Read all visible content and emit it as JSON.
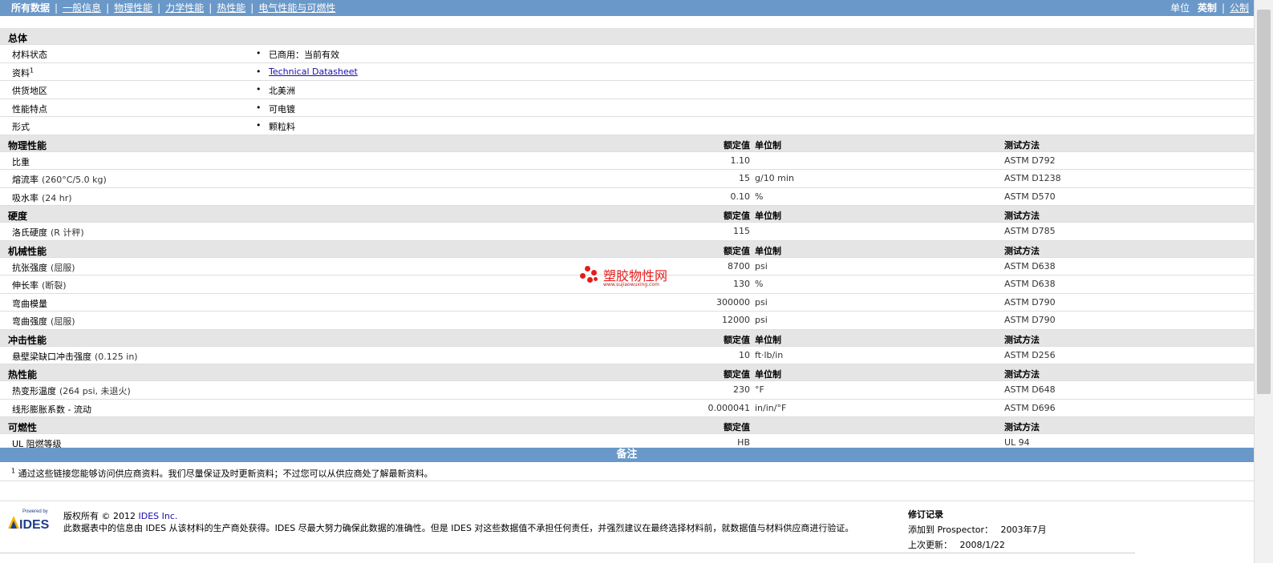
{
  "nav": {
    "items": [
      "所有数据",
      "一般信息",
      "物理性能",
      "力学性能",
      "热性能",
      "电气性能与可燃性"
    ],
    "units_label": "单位",
    "english": "英制",
    "metric": "公制"
  },
  "general": {
    "title": "总体",
    "rows": [
      {
        "label": "材料状态",
        "value": "已商用：当前有效"
      },
      {
        "label": "资料",
        "sup": "1",
        "value": "Technical Datasheet"
      },
      {
        "label": "供货地区",
        "value": "北美洲"
      },
      {
        "label": "性能特点",
        "value": "可电镀"
      },
      {
        "label": "形式",
        "value": "颗粒料"
      }
    ]
  },
  "col_headers": {
    "value": "额定值",
    "unit": "单位制",
    "method": "测试方法"
  },
  "sections": [
    {
      "title": "物理性能",
      "rows": [
        {
          "label": "比重",
          "cond": "",
          "value": "1.10",
          "unit": "",
          "method": "ASTM D792"
        },
        {
          "label": "熔流率",
          "cond": "(260°C/5.0 kg)",
          "value": "15",
          "unit": "g/10 min",
          "method": "ASTM D1238"
        },
        {
          "label": "吸水率",
          "cond": "(24 hr)",
          "value": "0.10",
          "unit": "%",
          "method": "ASTM D570"
        }
      ]
    },
    {
      "title": "硬度",
      "rows": [
        {
          "label": "洛氏硬度",
          "cond": "(R 计秤)",
          "value": "115",
          "unit": "",
          "method": "ASTM D785"
        }
      ]
    },
    {
      "title": "机械性能",
      "rows": [
        {
          "label": "抗张强度",
          "cond": "(屈服)",
          "value": "8700",
          "unit": "psi",
          "method": "ASTM D638"
        },
        {
          "label": "伸长率",
          "cond": "(断裂)",
          "value": "130",
          "unit": "%",
          "method": "ASTM D638"
        },
        {
          "label": "弯曲模量",
          "cond": "",
          "value": "300000",
          "unit": "psi",
          "method": "ASTM D790"
        },
        {
          "label": "弯曲强度",
          "cond": "(屈服)",
          "value": "12000",
          "unit": "psi",
          "method": "ASTM D790"
        }
      ]
    },
    {
      "title": "冲击性能",
      "rows": [
        {
          "label": "悬壁梁缺口冲击强度",
          "cond": "(0.125 in)",
          "value": "10",
          "unit": "ft·lb/in",
          "method": "ASTM D256"
        }
      ]
    },
    {
      "title": "热性能",
      "rows": [
        {
          "label": "热变形温度",
          "cond": "(264 psi, 未退火)",
          "value": "230",
          "unit": "°F",
          "method": "ASTM D648"
        },
        {
          "label": "线形膨胀系数 - 流动",
          "cond": "",
          "value": "0.000041",
          "unit": "in/in/°F",
          "method": "ASTM D696"
        }
      ]
    },
    {
      "title": "可燃性",
      "no_unit": true,
      "rows": [
        {
          "label": "UL 阻燃等级",
          "cond": "",
          "value": "HB",
          "unit": "",
          "method": "UL 94"
        }
      ]
    }
  ],
  "notes": {
    "title": "备注",
    "sup": "1",
    "text": "通过这些链接您能够访问供应商资料。我们尽量保证及时更新资料；不过您可以从供应商处了解最新资料。"
  },
  "footer": {
    "logo_small": "Powered by",
    "logo_text": "IDES",
    "copyright": "版权所有 © 2012",
    "company_link": "IDES Inc.",
    "disclaimer": "此数据表中的信息由 IDES 从该材料的生产商处获得。IDES 尽最大努力确保此数据的准确性。但是 IDES 对这些数据值不承担任何责任，并强烈建议在最终选择材料前，就数据值与材料供应商进行验证。",
    "revision_title": "修订记录",
    "added_label": "添加到 Prospector：",
    "added_value": "2003年7月",
    "updated_label": "上次更新：",
    "updated_value": "2008/1/22"
  },
  "watermark": {
    "title": "塑胶物性网",
    "url": "www.sujiaowuxing.com"
  },
  "colors": {
    "accent": "#6a98c8",
    "section_bg": "#e5e5e5"
  }
}
